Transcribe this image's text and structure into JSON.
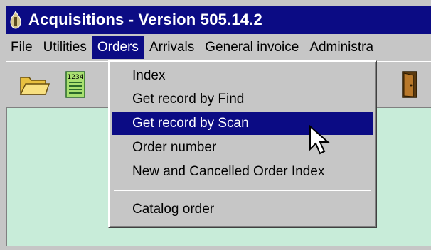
{
  "window": {
    "title": "Acquisitions - Version 505.14.2",
    "title_icon": "app-icon"
  },
  "menubar": {
    "items": [
      {
        "label": "File"
      },
      {
        "label": "Utilities"
      },
      {
        "label": "Orders",
        "active": true
      },
      {
        "label": "Arrivals"
      },
      {
        "label": "General invoice"
      },
      {
        "label": "Administra"
      }
    ]
  },
  "toolbar": {
    "buttons": [
      {
        "icon": "open-folder-icon"
      },
      {
        "icon": "numeric-list-icon",
        "glyph": "1234"
      },
      {
        "icon": "exit-door-icon"
      }
    ]
  },
  "orders_menu": {
    "items": [
      {
        "label": "Index"
      },
      {
        "label": "Get record by Find"
      },
      {
        "label": "Get record by Scan",
        "selected": true
      },
      {
        "label": "Order number"
      },
      {
        "label": "New and Cancelled Order Index"
      },
      {
        "label": "Catalog order"
      }
    ]
  },
  "colors": {
    "titlebar": "#0b0b84",
    "selection": "#0b0b84",
    "chrome": "#c6c6c6",
    "client_area": "#c8ecd9"
  }
}
